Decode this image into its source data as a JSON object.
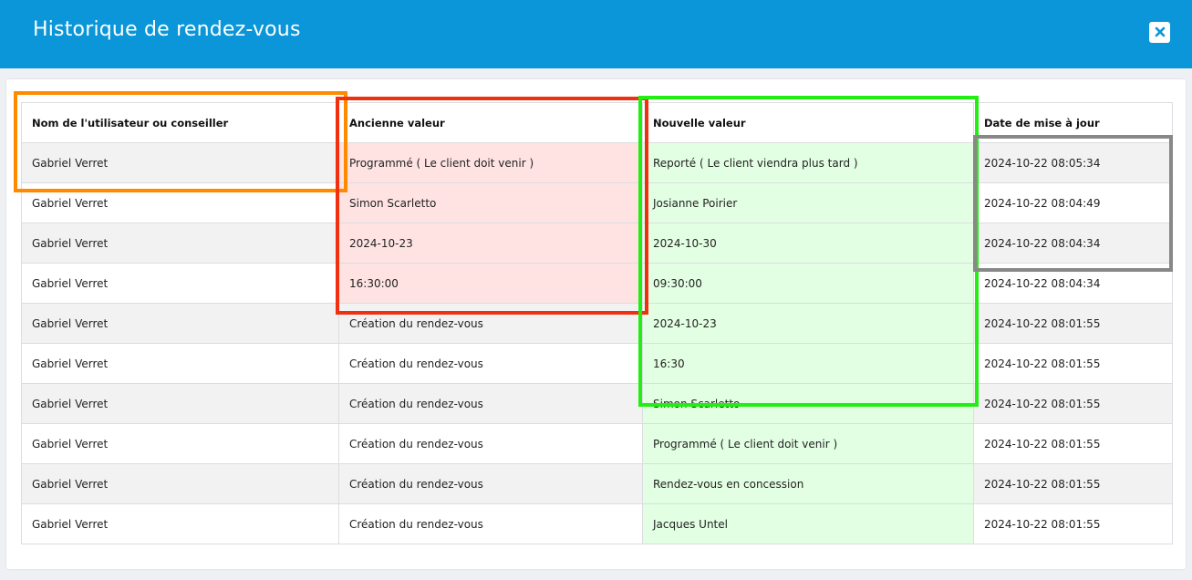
{
  "modal": {
    "title": "Historique de rendez-vous",
    "close_icon": "close-icon"
  },
  "table": {
    "headers": [
      "Nom de l'utilisateur ou conseiller",
      "Ancienne valeur",
      "Nouvelle valeur",
      "Date de mise à jour"
    ],
    "rows": [
      {
        "user": "Gabriel Verret",
        "old": "Programmé ( Le client doit venir )",
        "new": "Reporté ( Le client viendra plus tard )",
        "date": "2024-10-22 08:05:34",
        "old_highlighted": true
      },
      {
        "user": "Gabriel Verret",
        "old": "Simon Scarletto",
        "new": "Josianne Poirier",
        "date": "2024-10-22 08:04:49",
        "old_highlighted": true
      },
      {
        "user": "Gabriel Verret",
        "old": "2024-10-23",
        "new": "2024-10-30",
        "date": "2024-10-22 08:04:34",
        "old_highlighted": true
      },
      {
        "user": "Gabriel Verret",
        "old": "16:30:00",
        "new": "09:30:00",
        "date": "2024-10-22 08:04:34",
        "old_highlighted": true
      },
      {
        "user": "Gabriel Verret",
        "old": "Création du rendez-vous",
        "new": "2024-10-23",
        "date": "2024-10-22 08:01:55",
        "old_highlighted": false
      },
      {
        "user": "Gabriel Verret",
        "old": "Création du rendez-vous",
        "new": "16:30",
        "date": "2024-10-22 08:01:55",
        "old_highlighted": false
      },
      {
        "user": "Gabriel Verret",
        "old": "Création du rendez-vous",
        "new": "Simon Scarletto",
        "date": "2024-10-22 08:01:55",
        "old_highlighted": false
      },
      {
        "user": "Gabriel Verret",
        "old": "Création du rendez-vous",
        "new": "Programmé ( Le client doit venir )",
        "date": "2024-10-22 08:01:55",
        "old_highlighted": false
      },
      {
        "user": "Gabriel Verret",
        "old": "Création du rendez-vous",
        "new": "Rendez-vous en concession",
        "date": "2024-10-22 08:01:55",
        "old_highlighted": false
      },
      {
        "user": "Gabriel Verret",
        "old": "Création du rendez-vous",
        "new": "Jacques Untel",
        "date": "2024-10-22 08:01:55",
        "old_highlighted": false
      }
    ]
  },
  "colors": {
    "header_bg": "#0a96d8",
    "old_value_bg": "#ffe3e3",
    "new_value_bg": "#e3ffe3",
    "annotation_orange": "#ff8a00",
    "annotation_red": "#f03010",
    "annotation_green": "#22ee11",
    "annotation_gray": "#888888"
  }
}
